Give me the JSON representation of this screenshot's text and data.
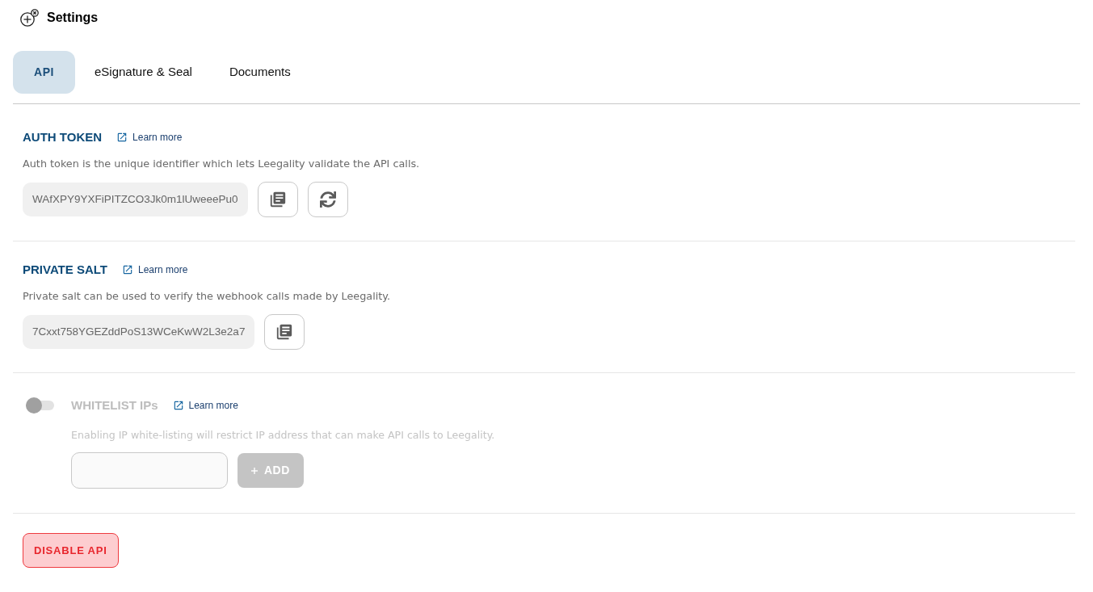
{
  "header": {
    "title": "Settings"
  },
  "tabs": [
    {
      "label": "API",
      "selected": true
    },
    {
      "label": "eSignature & Seal",
      "selected": false
    },
    {
      "label": "Documents",
      "selected": false
    }
  ],
  "sections": [
    {
      "kind": "secret",
      "title": "AUTH TOKEN",
      "link": "Learn more",
      "description": "Auth token is the unique identifier which lets Leegality validate the API calls.",
      "value": "WAfXPY9YXFiPITZCO3Jk0m1lUweeePu0",
      "buttons": [
        {
          "kind": "copy"
        },
        {
          "kind": "refresh"
        }
      ]
    },
    {
      "kind": "secret",
      "title": "PRIVATE SALT",
      "link": "Learn more",
      "description": "Private salt can be used to verify the webhook calls made by Leegality.",
      "value": "7Cxxt758YGEZddPoS13WCeKwW2L3e2a7",
      "buttons": [
        {
          "kind": "copy"
        }
      ]
    },
    {
      "kind": "toggle",
      "title": "WHITELIST IPs",
      "on": false,
      "link": "Learn more",
      "description": "Enabling IP white-listing will restrict IP address that can make API calls to Leegality.",
      "add_button": {
        "label": "ADD"
      }
    }
  ],
  "footer_button": {
    "label": "DISABLE API"
  }
}
